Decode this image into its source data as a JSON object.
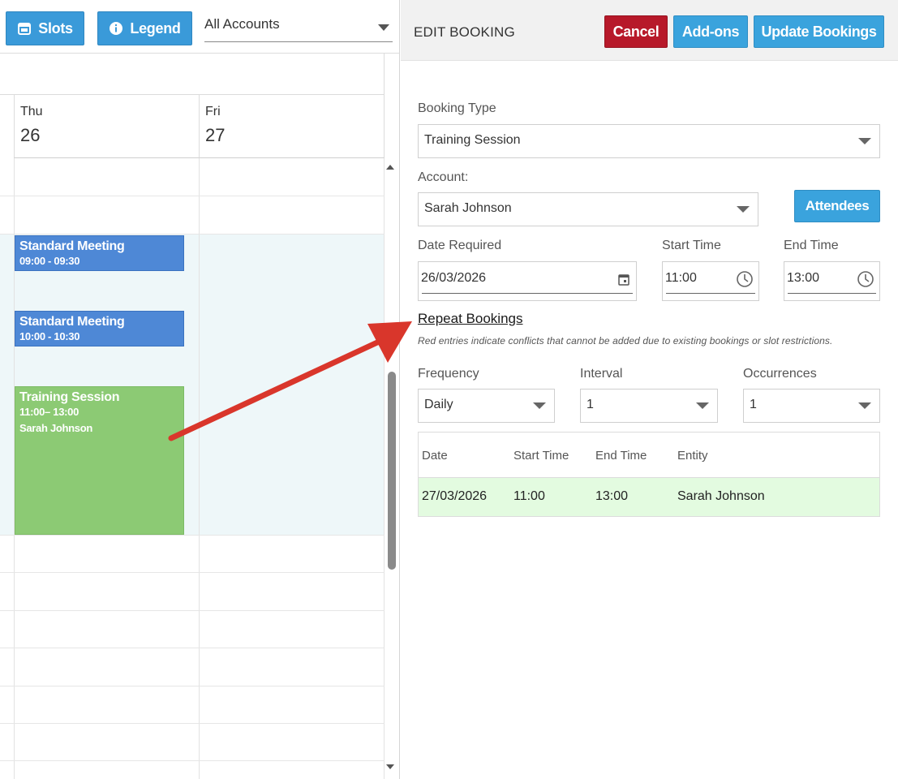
{
  "calendar": {
    "slots_button": "Slots",
    "legend_button": "Legend",
    "account_filter": "All Accounts",
    "days": [
      {
        "name": "Thu",
        "num": "26"
      },
      {
        "name": "Fri",
        "num": "27"
      }
    ],
    "events": [
      {
        "title": "Standard Meeting",
        "time": "09:00 - 09:30",
        "person": ""
      },
      {
        "title": "Standard Meeting",
        "time": "10:00 - 10:30",
        "person": ""
      },
      {
        "title": "Training Session",
        "time": "11:00– 13:00",
        "person": "Sarah Johnson"
      }
    ]
  },
  "edit": {
    "title": "EDIT BOOKING",
    "cancel": "Cancel",
    "addons": "Add-ons",
    "update": "Update Bookings",
    "booking_type_label": "Booking Type",
    "booking_type_value": "Training Session",
    "account_label": "Account:",
    "account_value": "Sarah Johnson",
    "attendees": "Attendees",
    "date_label": "Date Required",
    "date_value": "26/03/2026",
    "start_label": "Start Time",
    "start_value": "11:00",
    "end_label": "End Time",
    "end_value": "13:00",
    "repeat_link": "Repeat Bookings",
    "repeat_note": "Red entries indicate conflicts that cannot be added due to existing bookings or slot restrictions.",
    "frequency_label": "Frequency",
    "frequency_value": "Daily",
    "interval_label": "Interval",
    "interval_value": "1",
    "occurrences_label": "Occurrences",
    "occurrences_value": "1",
    "table": {
      "headers": [
        "Date",
        "Start Time",
        "End Time",
        "Entity"
      ],
      "rows": [
        [
          "27/03/2026",
          "11:00",
          "13:00",
          "Sarah Johnson"
        ]
      ]
    }
  },
  "colors": {
    "meeting": "#4e88d6",
    "training": "#8cca74",
    "cancel": "#b7192a",
    "primary": "#3aa3dd",
    "arrow": "#d9362b",
    "row_ok": "#e3fbe0"
  }
}
